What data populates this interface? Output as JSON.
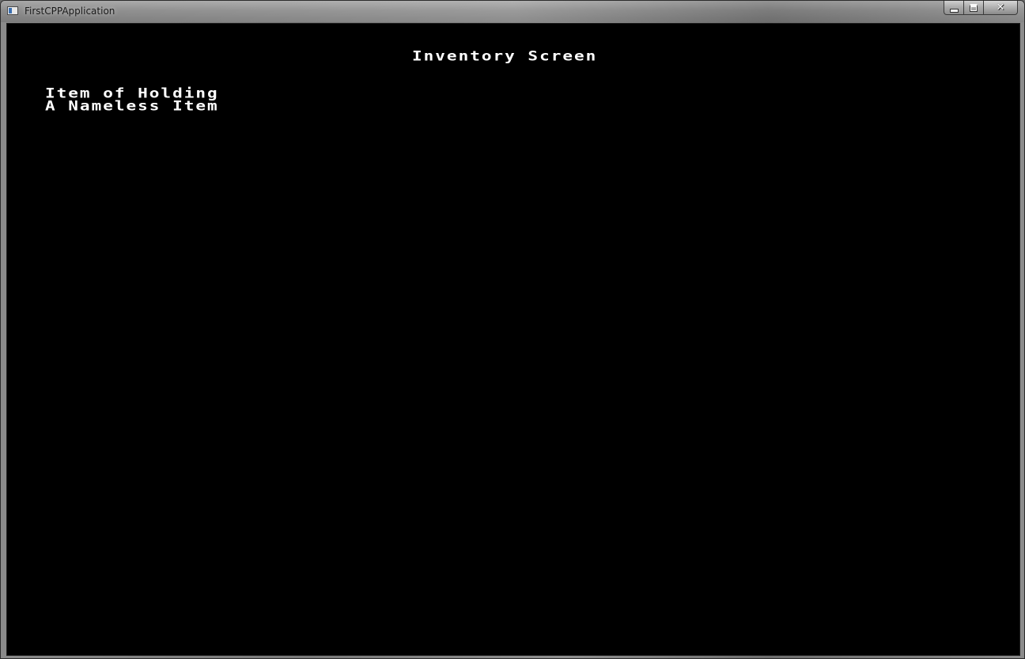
{
  "window": {
    "title": "FirstCPPApplication"
  },
  "caption_buttons": {
    "minimize_icon": "minimize-icon",
    "maximize_icon": "maximize-icon",
    "close_icon": "close-icon",
    "close_glyph": "✕"
  },
  "screen": {
    "title": "Inventory Screen",
    "items": [
      {
        "label": "Item of Holding"
      },
      {
        "label": "A Nameless Item"
      }
    ]
  },
  "colors": {
    "background": "#000000",
    "text": "#ffffff"
  }
}
